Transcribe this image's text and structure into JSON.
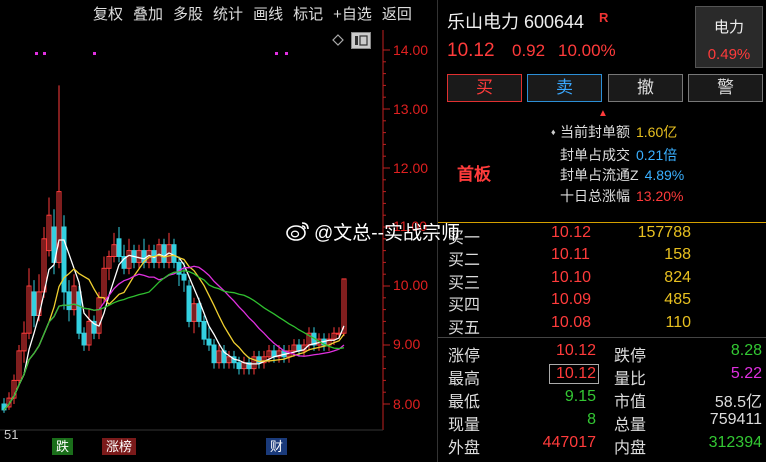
{
  "toolbar": {
    "items": [
      "复权",
      "叠加",
      "多股",
      "统计",
      "画线",
      "标记",
      "+自选",
      "返回"
    ]
  },
  "chart": {
    "price_ticks": [
      "14.00",
      "13.00",
      "12.00",
      "11.00",
      "10.00",
      "9.00",
      "8.00"
    ],
    "left_edge_label": "51",
    "markers": {
      "fall": "跌",
      "up_list": "涨榜",
      "finance": "财"
    },
    "colors": {
      "up": "#ff3b3b",
      "down": "#33d0e0",
      "ma5": "#ffffff",
      "ma10": "#f0d030",
      "ma20": "#e030e0",
      "ma30": "#30c030"
    }
  },
  "quote": {
    "name_code": "乐山电力 600644",
    "badge": "R",
    "price": "10.12",
    "change": "0.92",
    "change_pct": "10.00%"
  },
  "sector": {
    "name": "电力",
    "pct": "0.49%"
  },
  "actions": {
    "buy": "买",
    "sell": "卖",
    "cancel": "撤",
    "alert": "警"
  },
  "seal": {
    "board": "首板",
    "rows": [
      {
        "label": "当前封单额",
        "value": "1.60亿",
        "color": "#e8c020"
      },
      {
        "label": "封单占成交",
        "value": "0.21倍",
        "color": "#3ab0ff"
      },
      {
        "label": "封单占流通Z",
        "value": "4.89%",
        "color": "#3ab0ff"
      },
      {
        "label": "十日总涨幅",
        "value": "13.20%",
        "color": "#ff3b3b"
      }
    ]
  },
  "order_book": [
    {
      "label": "买一",
      "price": "10.12",
      "vol": "157788"
    },
    {
      "label": "买二",
      "price": "10.11",
      "vol": "158"
    },
    {
      "label": "买三",
      "price": "10.10",
      "vol": "824"
    },
    {
      "label": "买四",
      "price": "10.09",
      "vol": "485"
    },
    {
      "label": "买五",
      "price": "10.08",
      "vol": "110"
    }
  ],
  "stats": {
    "limit_up_label": "涨停",
    "limit_up": "10.12",
    "limit_down_label": "跌停",
    "limit_down": "8.28",
    "high_label": "最高",
    "high": "10.12",
    "vol_ratio_label": "量比",
    "vol_ratio": "5.22",
    "low_label": "最低",
    "low": "9.15",
    "mkt_cap_label": "市值",
    "mkt_cap": "58.5亿",
    "cur_vol_label": "现量",
    "cur_vol": "8",
    "total_vol_label": "总量",
    "total_vol": "759411",
    "outer_label": "外盘",
    "outer": "447017",
    "inner_label": "内盘",
    "inner": "312394"
  },
  "watermark": "@文总--实战宗师"
}
